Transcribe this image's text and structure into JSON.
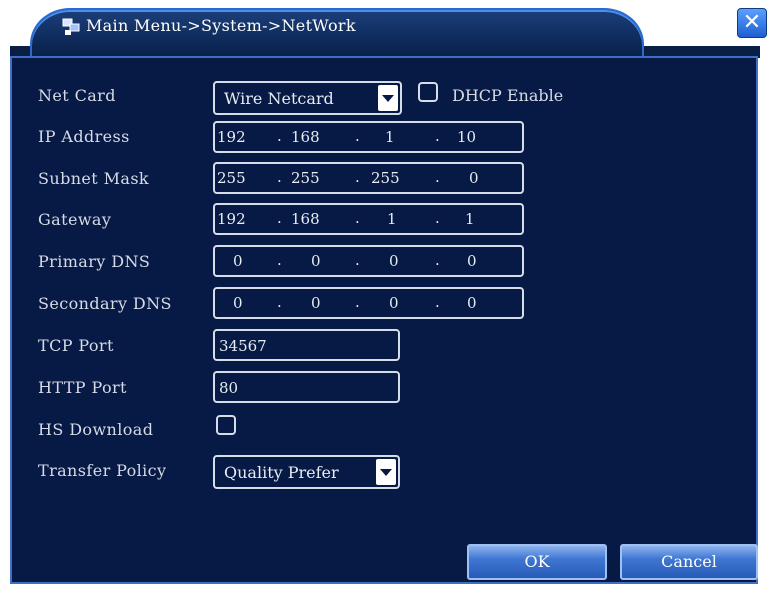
{
  "window": {
    "title": "Main Menu->System->NetWork",
    "close_glyph": "✕",
    "title_icon": "network-icon"
  },
  "form": {
    "net_card": {
      "label": "Net Card",
      "value": "Wire Netcard"
    },
    "dhcp": {
      "label": "DHCP Enable",
      "checked": false
    },
    "ip_address": {
      "label": "IP Address",
      "octets": [
        "192",
        "168",
        "1",
        "10"
      ]
    },
    "subnet_mask": {
      "label": "Subnet Mask",
      "octets": [
        "255",
        "255",
        "255",
        "0"
      ]
    },
    "gateway": {
      "label": "Gateway",
      "octets": [
        "192",
        "168",
        "1",
        "1"
      ]
    },
    "primary_dns": {
      "label": "Primary DNS",
      "octets": [
        "0",
        "0",
        "0",
        "0"
      ]
    },
    "secondary_dns": {
      "label": "Secondary DNS",
      "octets": [
        "0",
        "0",
        "0",
        "0"
      ]
    },
    "tcp_port": {
      "label": "TCP Port",
      "value": "34567"
    },
    "http_port": {
      "label": "HTTP Port",
      "value": "80"
    },
    "hs_download": {
      "label": "HS Download",
      "checked": false
    },
    "transfer_policy": {
      "label": "Transfer Policy",
      "value": "Quality Prefer"
    }
  },
  "buttons": {
    "ok": "OK",
    "cancel": "Cancel"
  },
  "colors": {
    "panel_bg": "#061a45",
    "border": "#3f6ec4",
    "button": "#3f77d2"
  }
}
